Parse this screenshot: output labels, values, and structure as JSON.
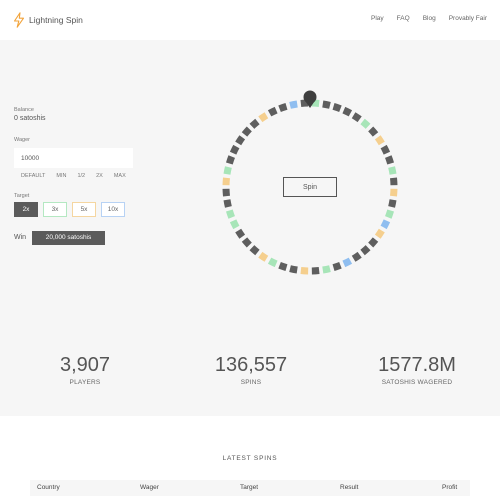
{
  "header": {
    "brand": "Lightning Spin",
    "nav": [
      "Play",
      "FAQ",
      "Blog",
      "Provably Fair"
    ]
  },
  "controls": {
    "balance_label": "Balance",
    "balance_value": "0 satoshis",
    "wager_label": "Wager",
    "wager_value": "10000",
    "presets": [
      "DEFAULT",
      "MIN",
      "1/2",
      "2X",
      "MAX"
    ],
    "target_label": "Target",
    "targets": [
      "2x",
      "3x",
      "5x",
      "10x"
    ],
    "selected_target": "2x",
    "win_label": "Win",
    "win_value": "20,000 satoshis"
  },
  "wheel": {
    "spin_label": "Spin",
    "segments": [
      "green",
      "gray",
      "gray",
      "gray",
      "gray",
      "green",
      "gray",
      "orange",
      "gray",
      "gray",
      "green",
      "gray",
      "orange",
      "gray",
      "green",
      "blue",
      "orange",
      "gray",
      "gray",
      "gray",
      "blue",
      "gray",
      "green",
      "gray",
      "orange",
      "gray",
      "gray",
      "green",
      "orange",
      "gray",
      "gray",
      "gray",
      "green",
      "green",
      "gray",
      "gray",
      "orange",
      "green",
      "gray",
      "gray",
      "gray",
      "gray",
      "gray",
      "orange",
      "gray",
      "gray",
      "blue",
      "gray"
    ],
    "colors": {
      "gray": "#5e5e5e",
      "green": "#a7e5b8",
      "orange": "#f5cf8e",
      "blue": "#8fbef0"
    },
    "accent": "#f2a33a"
  },
  "stats": [
    {
      "value": "3,907",
      "label": "PLAYERS"
    },
    {
      "value": "136,557",
      "label": "SPINS"
    },
    {
      "value": "1577.8M",
      "label": "SATOSHIS WAGERED"
    }
  ],
  "latest": {
    "title": "LATEST SPINS",
    "columns": [
      "Country",
      "Wager",
      "Target",
      "Result",
      "Profit"
    ]
  }
}
